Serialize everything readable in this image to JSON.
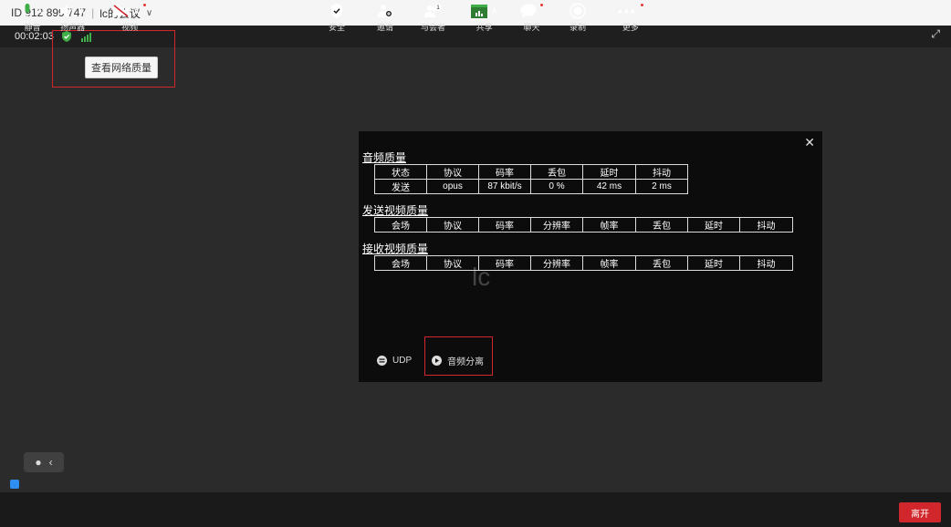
{
  "titlebar": {
    "meeting_id": "ID 912 899 747",
    "meeting_name": "lc的会议"
  },
  "topstrip": {
    "timer": "00:02:03"
  },
  "tooltip": {
    "text": "查看网络质量"
  },
  "watermark": {
    "text": "lc"
  },
  "dialog": {
    "audio_title": "音频质量",
    "audio_headers": [
      "状态",
      "协议",
      "码率",
      "丢包",
      "延时",
      "抖动"
    ],
    "audio_row": [
      "发送",
      "opus",
      "87 kbit/s",
      "0 %",
      "42 ms",
      "2 ms"
    ],
    "send_video_title": "发送视频质量",
    "video_headers": [
      "会场",
      "协议",
      "码率",
      "分辨率",
      "帧率",
      "丢包",
      "延时",
      "抖动"
    ],
    "recv_video_title": "接收视频质量",
    "udp_label": "UDP",
    "audio_split_label": "音频分离"
  },
  "toolbar": {
    "mute": "静音",
    "speaker": "扬声器",
    "video": "视频",
    "security": "安全",
    "invite": "邀请",
    "participants": "与会者",
    "share": "共享",
    "chat": "聊天",
    "record": "录制",
    "more": "更多",
    "leave": "离开"
  },
  "colors": {
    "accent_red": "#d0262c",
    "signal_green": "#3fae49",
    "avatar_blue": "#2e8ef0"
  }
}
